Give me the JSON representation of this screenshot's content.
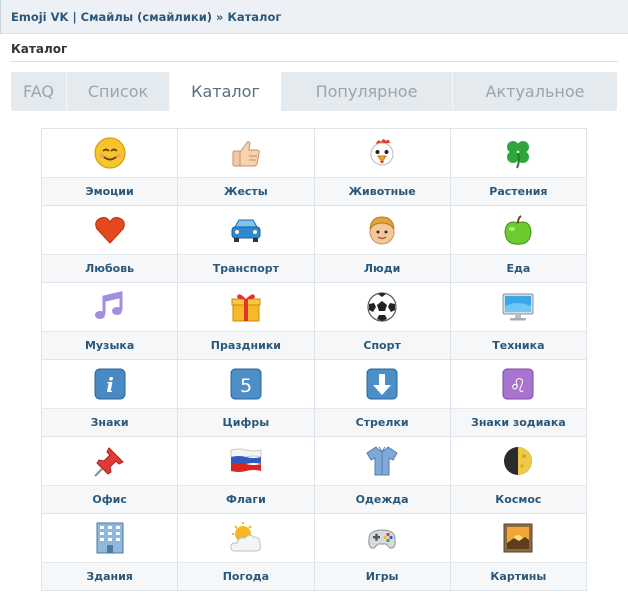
{
  "breadcrumb": {
    "app": "Emoji VK",
    "separator": "|",
    "section": "Смайлы (смайлики)",
    "arrow": "»",
    "current": "Каталог"
  },
  "page_title": "Каталог",
  "tabs": [
    {
      "label": "FAQ",
      "active": false
    },
    {
      "label": "Список",
      "active": false
    },
    {
      "label": "Каталог",
      "active": true
    },
    {
      "label": "Популярное",
      "active": false
    },
    {
      "label": "Актуальное",
      "active": false
    }
  ],
  "catalog": [
    [
      {
        "label": "Эмоции",
        "icon": "smiling-face-icon"
      },
      {
        "label": "Жесты",
        "icon": "thumbs-up-icon"
      },
      {
        "label": "Животные",
        "icon": "chicken-icon"
      },
      {
        "label": "Растения",
        "icon": "four-leaf-clover-icon"
      }
    ],
    [
      {
        "label": "Любовь",
        "icon": "heart-icon"
      },
      {
        "label": "Транспорт",
        "icon": "car-icon"
      },
      {
        "label": "Люди",
        "icon": "boy-face-icon"
      },
      {
        "label": "Еда",
        "icon": "green-apple-icon"
      }
    ],
    [
      {
        "label": "Музыка",
        "icon": "music-notes-icon"
      },
      {
        "label": "Праздники",
        "icon": "gift-icon"
      },
      {
        "label": "Спорт",
        "icon": "soccer-ball-icon"
      },
      {
        "label": "Техника",
        "icon": "computer-monitor-icon"
      }
    ],
    [
      {
        "label": "Знаки",
        "icon": "information-icon"
      },
      {
        "label": "Цифры",
        "icon": "digit-five-icon"
      },
      {
        "label": "Стрелки",
        "icon": "down-arrow-icon"
      },
      {
        "label": "Знаки зодиака",
        "icon": "leo-zodiac-icon"
      }
    ],
    [
      {
        "label": "Офис",
        "icon": "pushpin-icon"
      },
      {
        "label": "Флаги",
        "icon": "russia-flag-icon"
      },
      {
        "label": "Одежда",
        "icon": "shirt-icon"
      },
      {
        "label": "Космос",
        "icon": "half-moon-icon"
      }
    ],
    [
      {
        "label": "Здания",
        "icon": "office-building-icon"
      },
      {
        "label": "Погода",
        "icon": "sun-behind-cloud-icon"
      },
      {
        "label": "Игры",
        "icon": "game-controller-icon"
      },
      {
        "label": "Картины",
        "icon": "sunrise-picture-icon"
      }
    ]
  ],
  "icon_text": {
    "five": "5",
    "info": "i",
    "leo": "♌"
  },
  "colors": {
    "link": "#2b587a",
    "tab_bar": "#e5eaee",
    "label_bg": "#f6f7f9"
  }
}
